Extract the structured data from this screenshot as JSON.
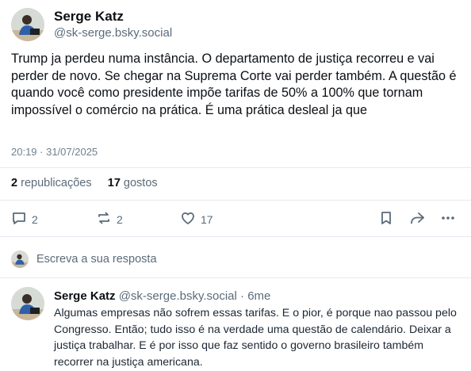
{
  "post": {
    "author_name": "Serge Katz",
    "author_handle": "@sk-serge.bsky.social",
    "text": "Trump ja perdeu numa instância. O departamento de justiça recorreu e vai perder de novo. Se chegar na Suprema Corte vai perder também. A questão é quando você como presidente impõe tarifas de 50% a 100% que tornam impossível o comércio na prática. É uma prática desleal ja que",
    "timestamp": "20:19 · 31/07/2025",
    "stats": {
      "reposts_count": "2",
      "reposts_label": "republicações",
      "likes_count": "17",
      "likes_label": "gostos"
    },
    "actions": {
      "reply_count": "2",
      "repost_count": "2",
      "like_count": "17",
      "icons": [
        "reply-icon",
        "repost-icon",
        "like-icon",
        "bookmark-icon",
        "share-icon",
        "more-icon"
      ]
    }
  },
  "reply_composer": {
    "placeholder": "Escreva a sua resposta"
  },
  "reply": {
    "author_name": "Serge Katz",
    "author_handle": "@sk-serge.bsky.social",
    "time": "· 6me",
    "text": "Algumas empresas não sofrem essas tarifas. E o pior, é porque nao passou pelo Congresso. Então; tudo isso é na verdade uma questão de calendário. Deixar a justiça trabalhar.  E é por isso que faz sentido o governo brasileiro também recorrer na justiça americana."
  },
  "colors": {
    "muted": "#5b6b7a",
    "divider": "#e5e9ee",
    "text": "#0b0f14"
  }
}
